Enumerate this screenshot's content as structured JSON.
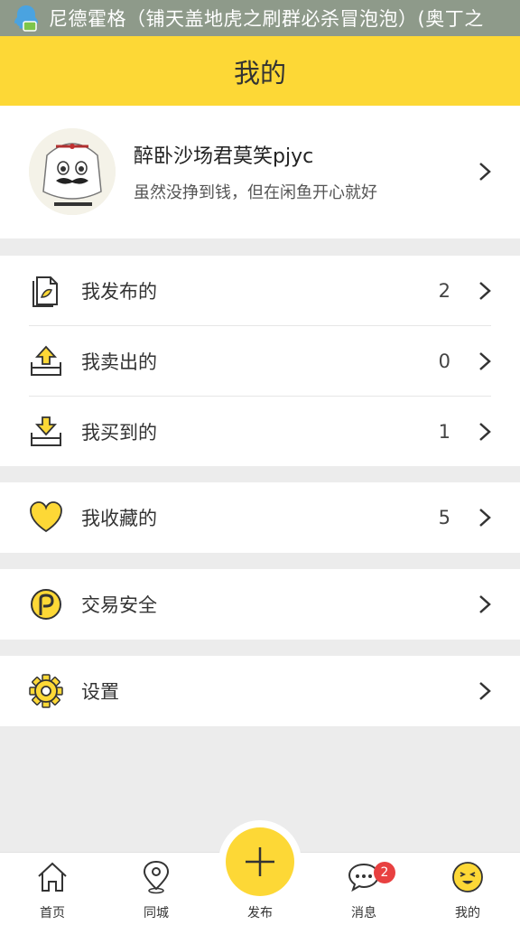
{
  "status_bar": {
    "text": "尼德霍格（铺天盖地虎之刷群必杀冒泡泡）(奥丁之"
  },
  "header": {
    "title": "我的"
  },
  "profile": {
    "name": "醉卧沙场君莫笑pjyc",
    "signature": "虽然没挣到钱，但在闲鱼开心就好",
    "avatar_icon": "avatar-cartoon-icon"
  },
  "menu": {
    "group1": [
      {
        "label": "我发布的",
        "count": "2",
        "icon": "document-icon"
      },
      {
        "label": "我卖出的",
        "count": "0",
        "icon": "upload-tray-icon"
      },
      {
        "label": "我买到的",
        "count": "1",
        "icon": "download-tray-icon"
      }
    ],
    "group2": [
      {
        "label": "我收藏的",
        "count": "5",
        "icon": "heart-icon"
      }
    ],
    "group3": [
      {
        "label": "交易安全",
        "count": "",
        "icon": "shield-p-icon"
      }
    ],
    "group4": [
      {
        "label": "设置",
        "count": "",
        "icon": "gear-icon"
      }
    ]
  },
  "tabbar": {
    "home": "首页",
    "nearby": "同城",
    "publish": "发布",
    "messages": "消息",
    "messages_badge": "2",
    "mine": "我的"
  },
  "colors": {
    "accent": "#fdd836",
    "badge": "#e84040",
    "background": "#ececec"
  }
}
